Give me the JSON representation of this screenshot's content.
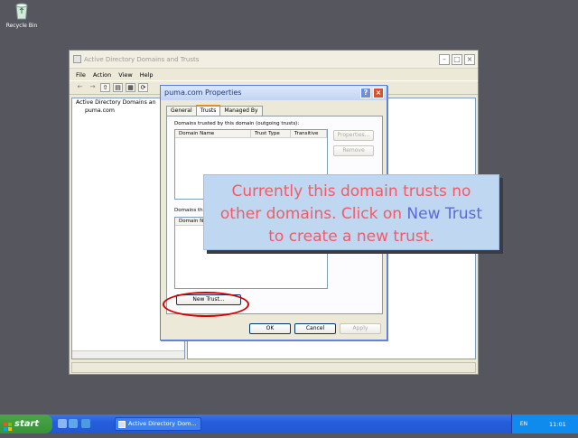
{
  "desktop": {
    "recycle_bin_label": "Recycle Bin"
  },
  "main_window": {
    "title": "Active Directory Domains and Trusts",
    "menu": [
      "File",
      "Action",
      "View",
      "Help"
    ],
    "tree": [
      "Active Directory Domains an",
      "puma.com"
    ]
  },
  "dialog": {
    "title": "puma.com Properties",
    "tabs": [
      "General",
      "Trusts",
      "Managed By"
    ],
    "active_tab": "Trusts",
    "outgoing_label": "Domains trusted by this domain (outgoing trusts):",
    "columns": [
      "Domain Name",
      "Trust Type",
      "Transitive"
    ],
    "properties_btn": "Properties...",
    "remove_btn": "Remove",
    "incoming_label": "Domains th",
    "incoming_column": "Domain N",
    "new_trust_btn": "New Trust...",
    "ok_btn": "OK",
    "cancel_btn": "Cancel",
    "apply_btn": "Apply"
  },
  "callout": {
    "part1": "Currently this domain trusts no other domains. Click on ",
    "highlight": "New Trust",
    "part2": " to create a new trust."
  },
  "taskbar": {
    "start": "start",
    "task": "Active Directory Dom...",
    "lang": "EN",
    "clock": "11:01"
  },
  "colors": {
    "callout_text": "#f55a64",
    "callout_highlight": "#5b6ad8",
    "annotation_ring": "#d40000"
  }
}
